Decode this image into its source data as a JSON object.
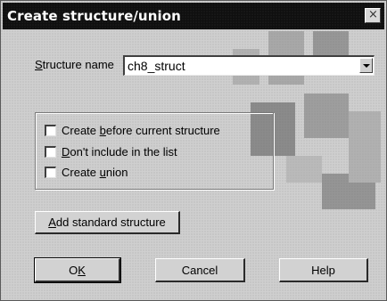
{
  "dialog": {
    "title": "Create structure/union",
    "close_glyph": "×"
  },
  "structure_name": {
    "label_prefix": "S",
    "label_rest": "tructure name",
    "value": "ch8_struct"
  },
  "options": [
    {
      "pre": "Create ",
      "key": "b",
      "post": "efore current structure",
      "checked": false
    },
    {
      "pre": "",
      "key": "D",
      "post": "on't include in the list",
      "checked": false
    },
    {
      "pre": "Create ",
      "key": "u",
      "post": "nion",
      "checked": false
    }
  ],
  "buttons": {
    "add_key": "A",
    "add_rest": "dd standard structure",
    "ok_pre": "O",
    "ok_key": "K",
    "cancel": "Cancel",
    "help": "Help"
  },
  "colors": {
    "titlebar": "#0f0f0f",
    "face": "#cfcfcf"
  }
}
